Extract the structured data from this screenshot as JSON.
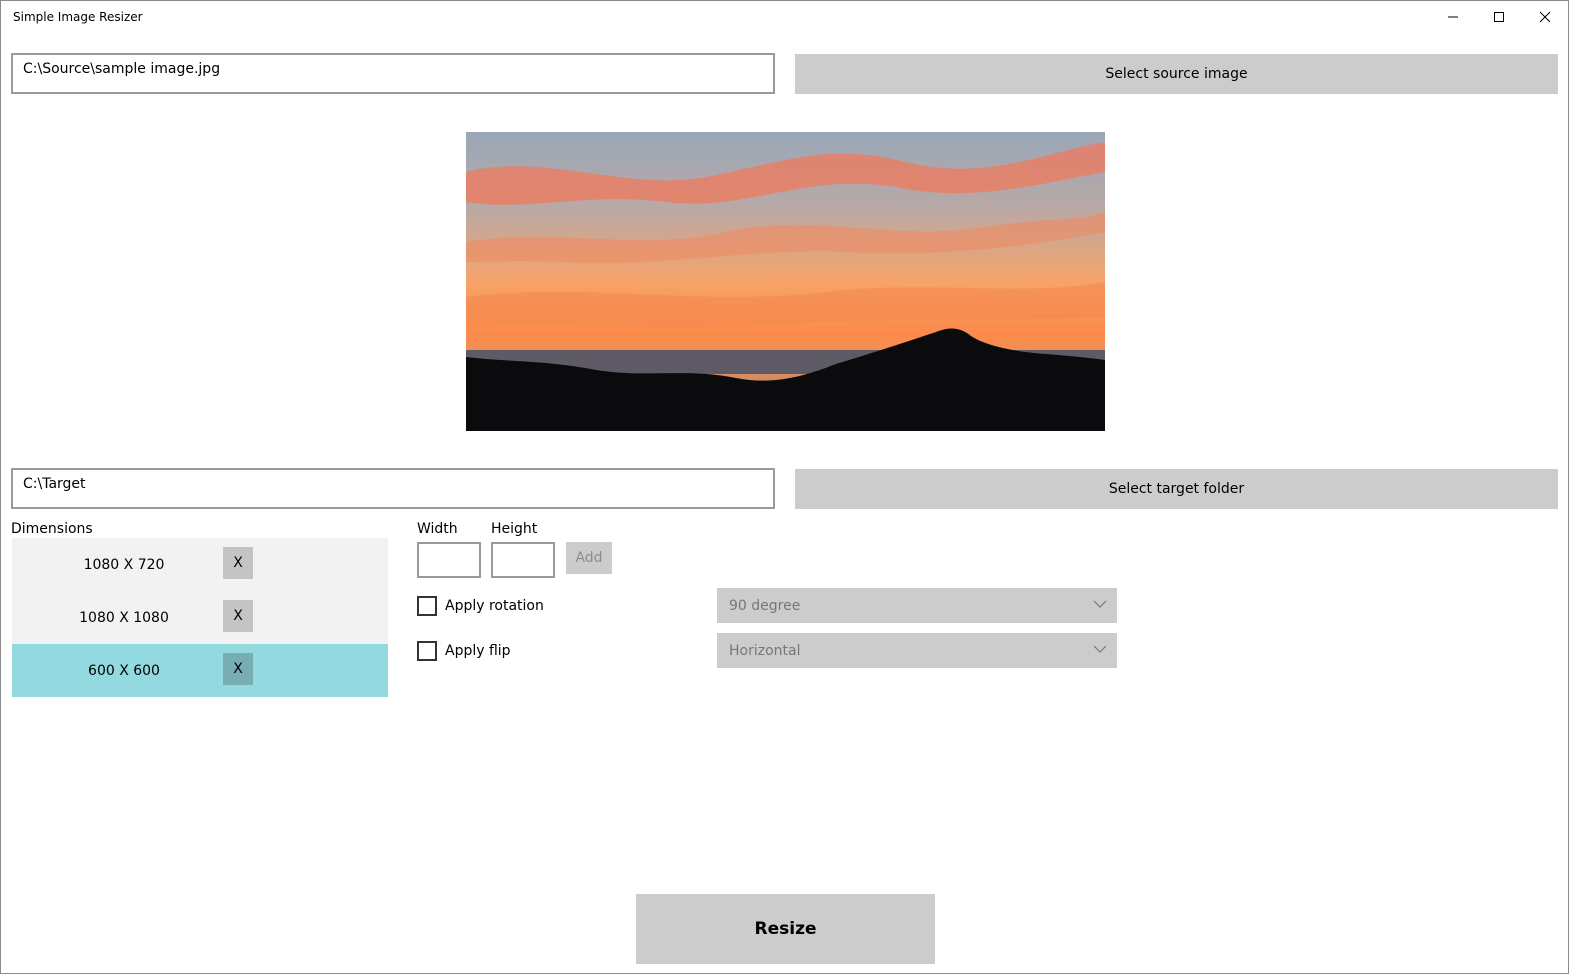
{
  "window": {
    "title": "Simple Image Resizer"
  },
  "source": {
    "path": "C:\\Source\\sample image.jpg",
    "select_label": "Select source image"
  },
  "target": {
    "path": "C:\\Target",
    "select_label": "Select target folder"
  },
  "dimensions": {
    "label": "Dimensions",
    "items": [
      {
        "text": "1080 X 720",
        "remove": "X",
        "selected": false
      },
      {
        "text": "1080 X 1080",
        "remove": "X",
        "selected": false
      },
      {
        "text": "600 X 600",
        "remove": "X",
        "selected": true
      }
    ]
  },
  "size_entry": {
    "width_label": "Width",
    "height_label": "Height",
    "width_value": "",
    "height_value": "",
    "add_label": "Add"
  },
  "rotation": {
    "label": "Apply rotation",
    "checked": false,
    "selected": "90 degree"
  },
  "flip": {
    "label": "Apply flip",
    "checked": false,
    "selected": "Horizontal"
  },
  "actions": {
    "resize_label": "Resize"
  },
  "colors": {
    "selected_row": "#93dae0",
    "button_gray": "#cccccc"
  },
  "icons": {
    "minimize": "minimize-icon",
    "maximize": "maximize-icon",
    "close": "close-icon",
    "dropdown": "chevron-down-icon"
  }
}
